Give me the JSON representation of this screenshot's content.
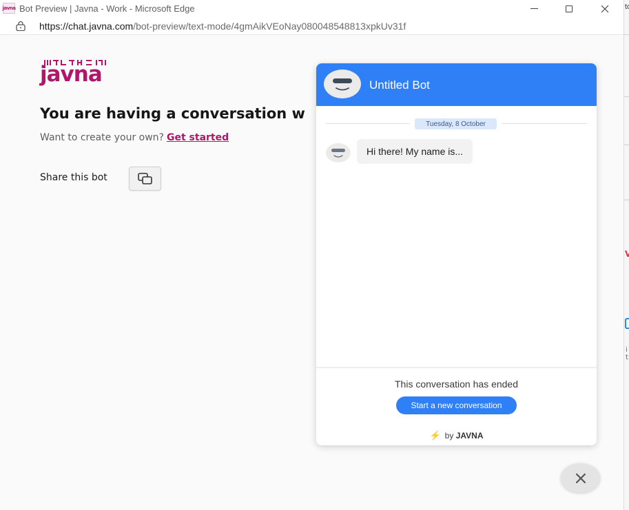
{
  "window": {
    "title": "Bot Preview | Javna - Work - Microsoft Edge",
    "app_icon_label": "javna"
  },
  "addressbar": {
    "url_host": "https://chat.javna.com",
    "url_path": "/bot-preview/text-mode/4gmAikVEoNay080048548813xpkUv31f"
  },
  "edge_strip": {
    "top_text": "to",
    "lower_text": "i t"
  },
  "page": {
    "logo_text": "javna",
    "headline": "You are having a conversation w",
    "subline": "Want to create your own?",
    "get_started": "Get started",
    "share_label": "Share this bot"
  },
  "chat": {
    "title": "Untitled Bot",
    "date": "Tuesday, 8 October",
    "message": "Hi there! My name is...",
    "ended_text": "This conversation has ended",
    "new_conversation": "Start a new conversation",
    "by_prefix": "by",
    "by_brand": "JAVNA",
    "accent_color": "#2f80f7"
  },
  "brand": {
    "primary_color": "#b0166b"
  }
}
